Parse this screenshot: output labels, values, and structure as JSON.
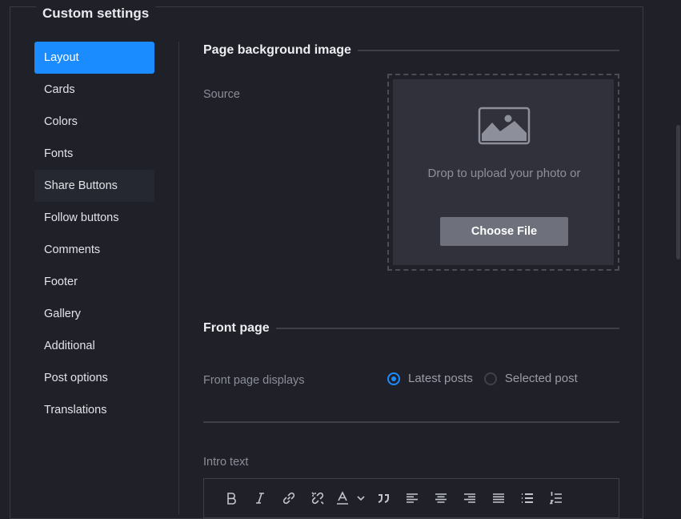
{
  "panel": {
    "title": "Custom settings"
  },
  "sidebar": {
    "items": [
      {
        "label": "Layout",
        "state": "active"
      },
      {
        "label": "Cards"
      },
      {
        "label": "Colors"
      },
      {
        "label": "Fonts"
      },
      {
        "label": "Share Buttons",
        "state": "hover"
      },
      {
        "label": "Follow buttons"
      },
      {
        "label": "Comments"
      },
      {
        "label": "Footer"
      },
      {
        "label": "Gallery"
      },
      {
        "label": "Additional"
      },
      {
        "label": "Post options"
      },
      {
        "label": "Translations"
      }
    ]
  },
  "background_section": {
    "title": "Page background image",
    "source_label": "Source",
    "dropzone_text": "Drop to upload your photo or",
    "choose_file_label": "Choose File"
  },
  "front_page": {
    "title": "Front page",
    "displays_label": "Front page displays",
    "options": [
      {
        "label": "Latest posts",
        "checked": true
      },
      {
        "label": "Selected post",
        "checked": false
      }
    ]
  },
  "intro": {
    "label": "Intro text",
    "toolbar_icons": [
      "bold-icon",
      "italic-icon",
      "link-icon",
      "unlink-icon",
      "text-color-icon",
      "chevron-down-icon",
      "quote-icon",
      "align-left-icon",
      "align-center-icon",
      "align-right-icon",
      "align-justify-icon",
      "bullet-list-icon",
      "numbered-list-icon"
    ]
  },
  "colors": {
    "accent": "#1a8cff",
    "background": "#1f2028",
    "dropzone": "#30313b",
    "button": "#6e717c"
  }
}
